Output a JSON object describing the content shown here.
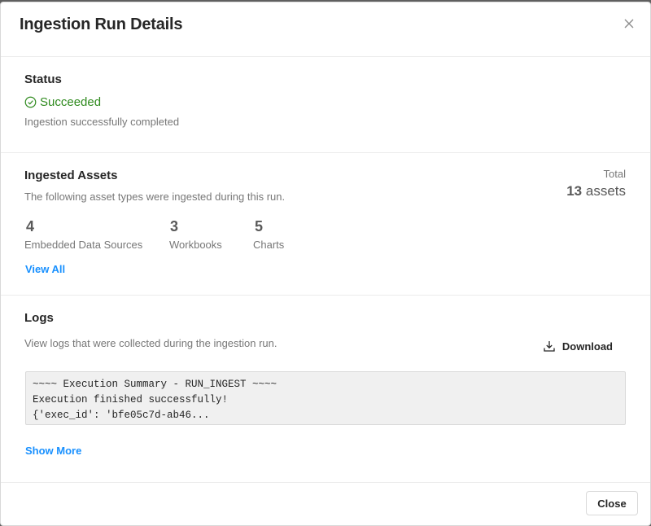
{
  "modal": {
    "title": "Ingestion Run Details"
  },
  "status": {
    "heading": "Status",
    "value": "Succeeded",
    "description": "Ingestion successfully completed",
    "icon": "check-circle-icon",
    "color": "#2f8a1e"
  },
  "assets": {
    "heading": "Ingested Assets",
    "description": "The following asset types were ingested during this run.",
    "total_label": "Total",
    "total_count": "13",
    "total_unit": "assets",
    "items": [
      {
        "count": "4",
        "label": "Embedded Data Sources"
      },
      {
        "count": "3",
        "label": "Workbooks"
      },
      {
        "count": "5",
        "label": "Charts"
      }
    ],
    "view_all": "View All"
  },
  "logs": {
    "heading": "Logs",
    "description": "View logs that were collected during the ingestion run.",
    "download_label": "Download",
    "download_icon": "download-icon",
    "lines": [
      "~~~~ Execution Summary - RUN_INGEST ~~~~",
      "Execution finished successfully!",
      "{'exec_id': 'bfe05c7d-ab46..."
    ],
    "show_more": "Show More"
  },
  "footer": {
    "close_label": "Close"
  },
  "colors": {
    "accent": "#1890ff",
    "success": "#2f8a1e"
  }
}
